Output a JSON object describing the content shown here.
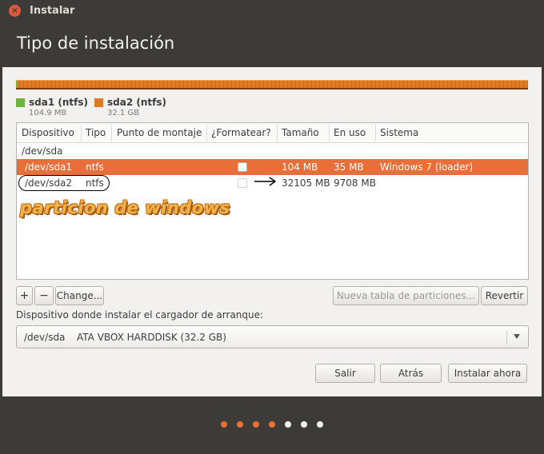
{
  "window": {
    "title": "Instalar"
  },
  "page": {
    "title": "Tipo de instalación"
  },
  "colors": {
    "accent": "#e86f3a",
    "sda1": "#6db33f",
    "sda2": "#e07a23",
    "background": "#3c3b37",
    "annotation": "#f0b44c"
  },
  "legend": [
    {
      "name": "sda1 (ntfs)",
      "size": "104.9 MB",
      "color": "#6db33f"
    },
    {
      "name": "sda2 (ntfs)",
      "size": "32.1 GB",
      "color": "#e07a23"
    }
  ],
  "table": {
    "columns": [
      "Dispositivo",
      "Tipo",
      "Punto de montaje",
      "¿Formatear?",
      "Tamaño",
      "En uso",
      "Sistema"
    ],
    "device_row": "/dev/sda",
    "rows": [
      {
        "device": "/dev/sda1",
        "type": "ntfs",
        "mount": "",
        "format": false,
        "size": "104 MB",
        "used": "35 MB",
        "system": "Windows 7 (loader)",
        "selected": true
      },
      {
        "device": "/dev/sda2",
        "type": "ntfs",
        "mount": "",
        "format": false,
        "size": "32105 MB",
        "used": "9708 MB",
        "system": "",
        "selected": false
      }
    ]
  },
  "annotation": {
    "text": "particion de windows"
  },
  "buttons": {
    "add": "+",
    "remove": "−",
    "change": "Change...",
    "new_table": "Nueva tabla de particiones...",
    "revert": "Revertir",
    "quit": "Salir",
    "back": "Atrás",
    "install": "Instalar ahora"
  },
  "bootloader": {
    "label": "Dispositivo donde instalar el cargador de arranque:",
    "device": "/dev/sda",
    "description": "ATA VBOX HARDDISK (32.2 GB)"
  },
  "progress": {
    "total_steps": 7,
    "completed_steps": 4
  }
}
